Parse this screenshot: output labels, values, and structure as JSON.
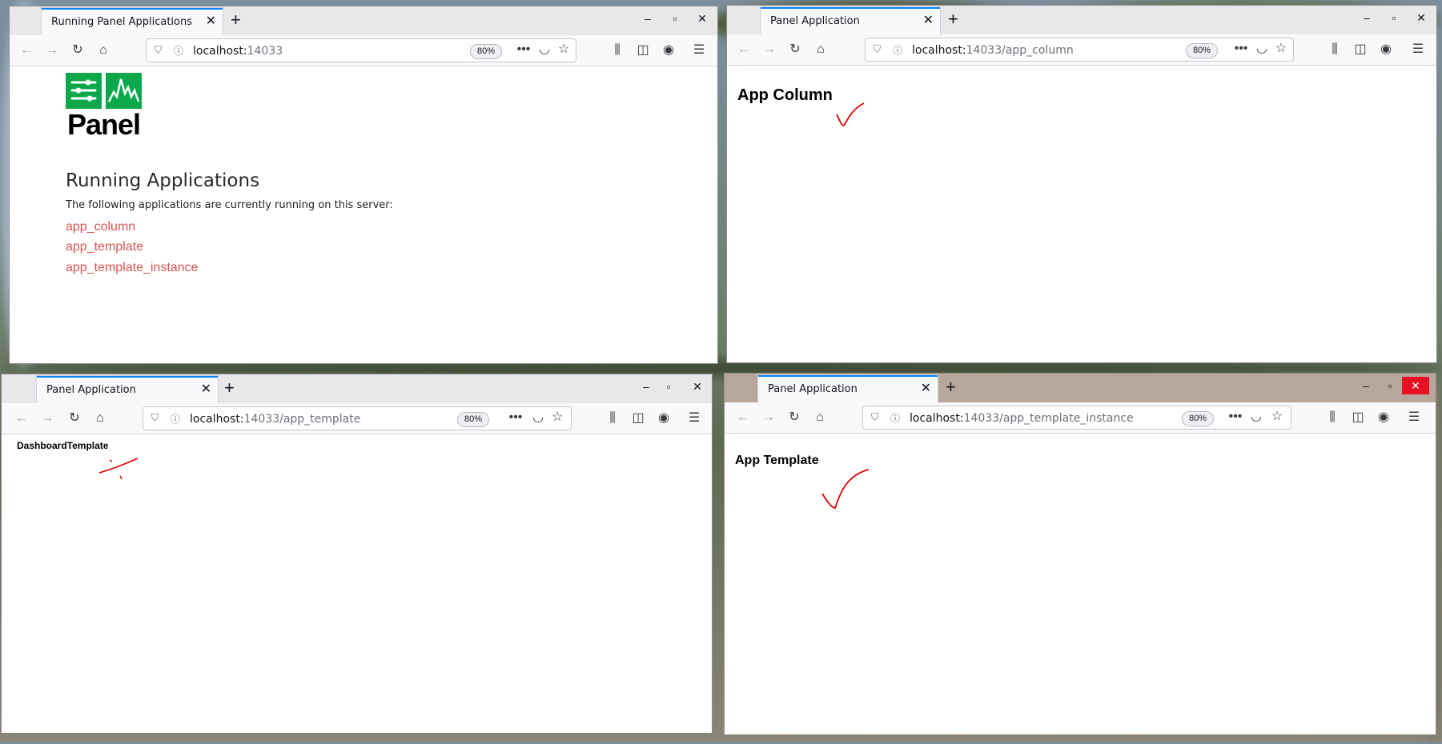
{
  "zoom_label": "80%",
  "windows": [
    {
      "tab_title": "Running Panel Applications",
      "url_host": "localhost:",
      "url_path": "14033",
      "logo_text": "Panel",
      "heading": "Running Applications",
      "description": "The following applications are currently running on this server:",
      "links": [
        "app_column",
        "app_template",
        "app_template_instance"
      ]
    },
    {
      "tab_title": "Panel Application",
      "url_host": "localhost:",
      "url_path": "14033/app_column",
      "heading": "App Column"
    },
    {
      "tab_title": "Panel Application",
      "url_host": "localhost:",
      "url_path": "14033/app_template",
      "heading": "DashboardTemplate"
    },
    {
      "tab_title": "Panel Application",
      "url_host": "localhost:",
      "url_path": "14033/app_template_instance",
      "heading": "App Template"
    }
  ],
  "colors": {
    "accent": "#0a84ff",
    "link": "#d9534f",
    "logo_green": "#0aa84b",
    "annotation": "#e00000"
  }
}
